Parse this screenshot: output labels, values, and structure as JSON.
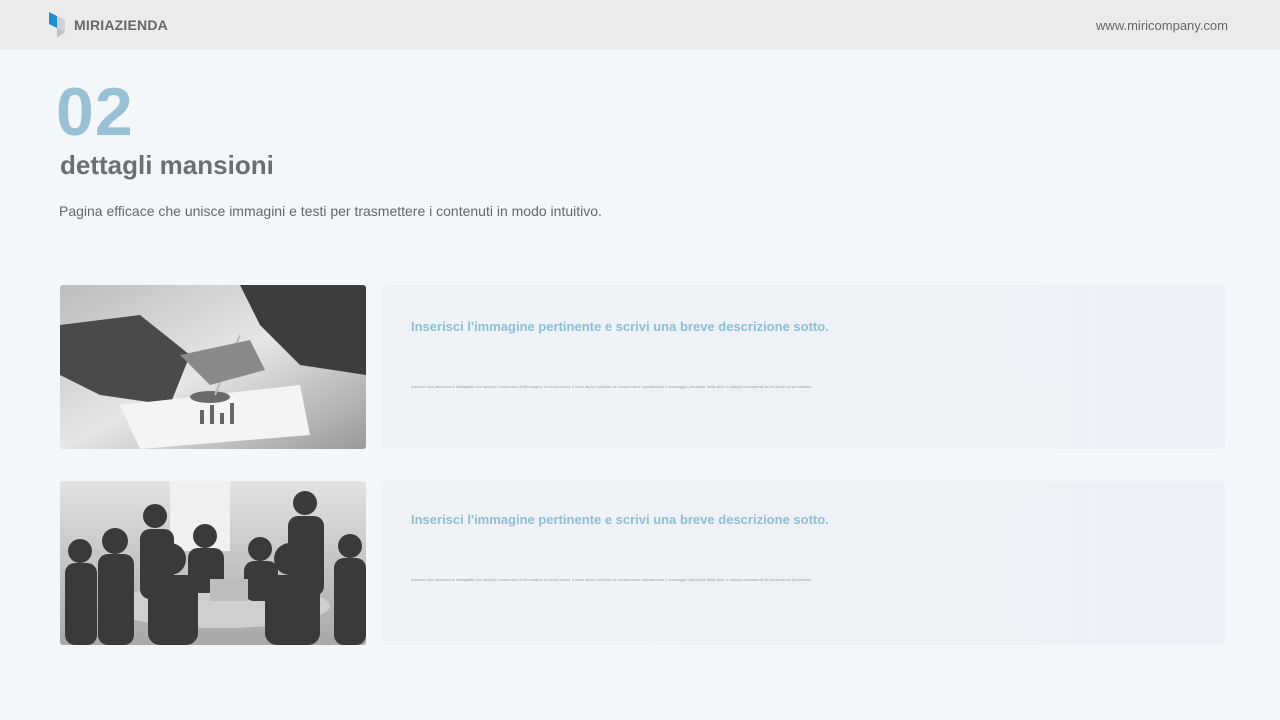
{
  "header": {
    "brand": "MIRIAZIENDA",
    "url": "www.miricompany.com"
  },
  "section": {
    "number": "02",
    "title": "dettagli mansioni",
    "description": "Pagina efficace che unisce immagini e testi per trasmettere i contenuti in modo intuitivo."
  },
  "items": [
    {
      "heading": "Inserisci l'immagine pertinente e scrivi una breve descrizione sotto.",
      "body": "Inserisci una descrizione dettagliata che spieghi il contenuto dell'immagine in modo chiaro. Il testo aiuta il pubblico a comprendere rapidamente il messaggio principale della slide e collega visivamente le informazioni presentate."
    },
    {
      "heading": "Inserisci l'immagine pertinente e scrivi una breve descrizione sotto.",
      "body": "Inserisci una descrizione dettagliata che spieghi il contenuto dell'immagine in modo chiaro. Il testo aiuta il pubblico a comprendere rapidamente il messaggio principale della slide e collega visivamente le informazioni presentate."
    }
  ],
  "colors": {
    "accent": "#9ac0d6",
    "heading_blue": "#8fbfd6",
    "logo_blue": "#1d8fd6"
  }
}
